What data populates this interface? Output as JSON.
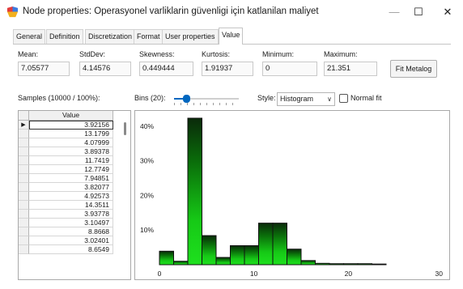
{
  "window": {
    "title": "Node properties: Operasyonel varliklarin güvenligi için katlanilan maliyet",
    "app_icon": "tricolor-app-icon",
    "controls": [
      "minimize-icon",
      "maximize-icon",
      "close-icon"
    ]
  },
  "tabs": [
    "General",
    "Definition",
    "Discretization",
    "Format",
    "User properties",
    "Value"
  ],
  "active_tab": "Value",
  "stats": {
    "mean_label": "Mean:",
    "mean": "7.05577",
    "stddev_label": "StdDev:",
    "stddev": "4.14576",
    "skewness_label": "Skewness:",
    "skewness": "0.449444",
    "kurtosis_label": "Kurtosis:",
    "kurtosis": "1.91937",
    "minimum_label": "Minimum:",
    "minimum": "0",
    "maximum_label": "Maximum:",
    "maximum": "21.351"
  },
  "fit_button": "Fit Metalog",
  "samples_label": "Samples (10000 / 100%):",
  "grid": {
    "column_header": "Value",
    "current_row_marker": "▶",
    "rows": [
      "3.92156",
      "13.1799",
      "4.07999",
      "3.89378",
      "11.7419",
      "12.7749",
      "7.94851",
      "3.82077",
      "4.92573",
      "14.3511",
      "3.93778",
      "3.10497",
      "8.8668",
      "3.02401",
      "8.6549"
    ]
  },
  "bins_label": "Bins (20):",
  "bins_value": 20,
  "style_label": "Style:",
  "style_value": "Histogram",
  "normal_fit_label": "Normal fit",
  "normal_fit_checked": false,
  "accent_color": "#0067c0",
  "bar_color": "#16c916",
  "chart_data": {
    "type": "bar",
    "bin_width": 1.5,
    "x_start": 0,
    "values": [
      3.9,
      1.0,
      42.3,
      8.4,
      2.1,
      5.5,
      5.5,
      12.0,
      12.0,
      4.5,
      1.2,
      0.4,
      0.3,
      0.3,
      0.3,
      0.2,
      0,
      0,
      0,
      0
    ],
    "xlim": [
      0,
      30
    ],
    "ylim": [
      0,
      43
    ],
    "x_ticks": [
      "0",
      "10",
      "20",
      "30"
    ],
    "y_ticks": [
      "10%",
      "20%",
      "30%",
      "40%"
    ],
    "y_tick_values": [
      10,
      20,
      30,
      40
    ],
    "x_tick_values": [
      0,
      10,
      20,
      30
    ],
    "title": "",
    "xlabel": "",
    "ylabel": "",
    "grid": false
  }
}
